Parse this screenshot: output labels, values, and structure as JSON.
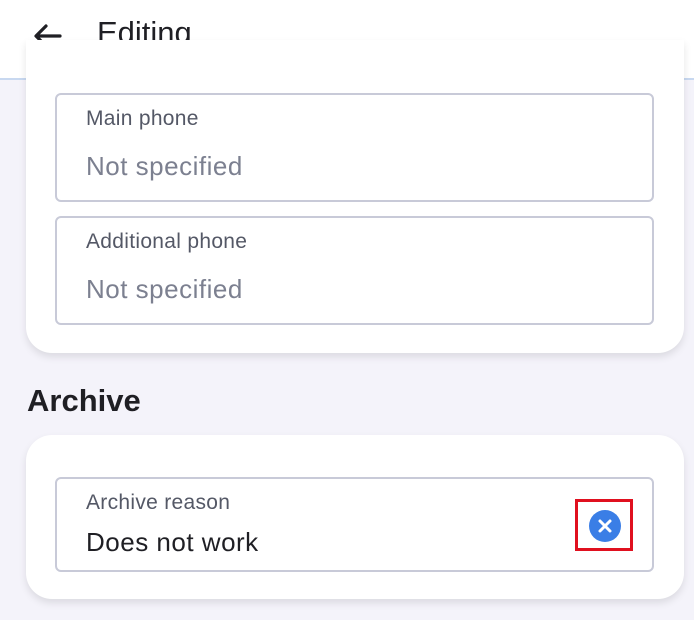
{
  "header": {
    "title": "Editing",
    "back_icon": "arrow-left-icon"
  },
  "contacts": {
    "main_phone": {
      "label": "Main phone",
      "value": "Not specified"
    },
    "additional_phone": {
      "label": "Additional phone",
      "value": "Not specified"
    }
  },
  "archive": {
    "section_title": "Archive",
    "reason": {
      "label": "Archive reason",
      "value": "Does not work",
      "clear_icon": "clear-circle-icon"
    }
  },
  "colors": {
    "accent": "#3a7ee6",
    "highlight": "#e0101f",
    "background": "#f4f3fa"
  }
}
